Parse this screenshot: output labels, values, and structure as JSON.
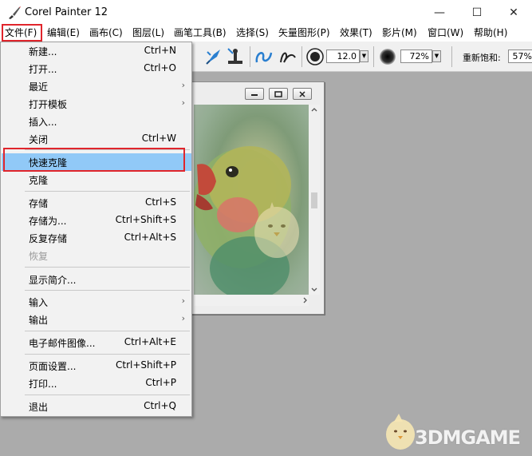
{
  "window": {
    "title": "Corel Painter 12",
    "minimize": "—",
    "maximize": "☐",
    "close": "✕"
  },
  "menubar": {
    "items": [
      {
        "label": "文件(F)"
      },
      {
        "label": "编辑(E)"
      },
      {
        "label": "画布(C)"
      },
      {
        "label": "图层(L)"
      },
      {
        "label": "画笔工具(B)"
      },
      {
        "label": "选择(S)"
      },
      {
        "label": "矢量图形(P)"
      },
      {
        "label": "效果(T)"
      },
      {
        "label": "影片(M)"
      },
      {
        "label": "窗口(W)"
      },
      {
        "label": "帮助(H)"
      }
    ]
  },
  "toolbar": {
    "size_value": "12.0",
    "opacity_value": "72%",
    "resaturation_label": "重新饱和:",
    "resaturation_value": "57%"
  },
  "file_menu": {
    "items": [
      {
        "label": "新建...",
        "shortcut": "Ctrl+N"
      },
      {
        "label": "打开...",
        "shortcut": "Ctrl+O"
      },
      {
        "label": "最近",
        "shortcut": "",
        "submenu": true
      },
      {
        "label": "打开模板",
        "shortcut": "",
        "submenu": true
      },
      {
        "label": "插入...",
        "shortcut": ""
      },
      {
        "label": "关闭",
        "shortcut": "Ctrl+W"
      },
      {
        "label": "快速克隆",
        "shortcut": "",
        "highlighted": true
      },
      {
        "label": "克隆",
        "shortcut": ""
      },
      {
        "label": "存储",
        "shortcut": "Ctrl+S"
      },
      {
        "label": "存储为...",
        "shortcut": "Ctrl+Shift+S"
      },
      {
        "label": "反复存储",
        "shortcut": "Ctrl+Alt+S"
      },
      {
        "label": "恢复",
        "shortcut": "",
        "disabled": true
      },
      {
        "label": "显示简介...",
        "shortcut": ""
      },
      {
        "label": "输入",
        "shortcut": "",
        "submenu": true
      },
      {
        "label": "输出",
        "shortcut": "",
        "submenu": true
      },
      {
        "label": "电子邮件图像...",
        "shortcut": "Ctrl+Alt+E"
      },
      {
        "label": "页面设置...",
        "shortcut": "Ctrl+Shift+P"
      },
      {
        "label": "打印...",
        "shortcut": "Ctrl+P"
      },
      {
        "label": "退出",
        "shortcut": "Ctrl+Q"
      }
    ],
    "submenu_arrow": "›"
  },
  "icons": {
    "app": "brush-icon",
    "watermark_mascot": "chick-mascot-icon"
  },
  "colors": {
    "highlight": "#91c9f7",
    "annotation_red": "#e0252c",
    "workspace": "#ababab"
  },
  "watermark": {
    "text": "3DMGAME"
  }
}
